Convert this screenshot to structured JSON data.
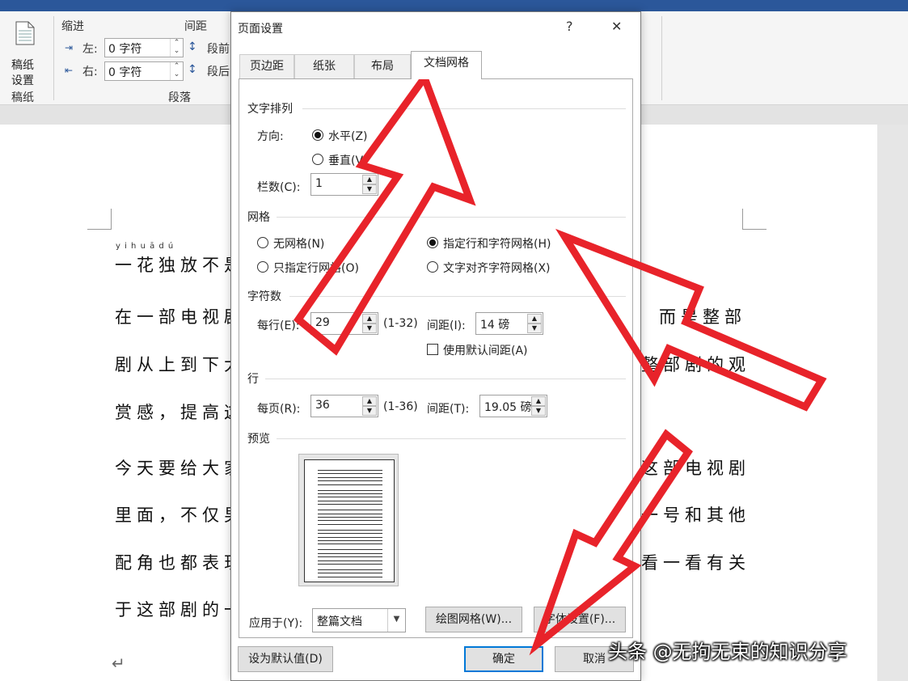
{
  "ribbon": {
    "gaozhi_btn": "稿纸\n设置",
    "gaozhi_label_l1": "稿纸",
    "gaozhi_label_l2": "设置",
    "gaozhi_group": "稿纸",
    "indent_title": "缩进",
    "spacing_title": "间距",
    "left_label": "左:",
    "left_value": "0 字符",
    "right_label": "右:",
    "right_value": "0 字符",
    "before_label": "段前",
    "after_label": "段后",
    "paragraph_group": "段落"
  },
  "document": {
    "pinyin": "y i h u ā d ú",
    "lines": [
      "一花独放不是",
      "在一部电视剧",
      "剧从上到下大",
      "赏感，提高这",
      "今天要给大家",
      "里面，不仅男",
      "配角也都表现",
      "于这部剧的一"
    ],
    "right_fragments": [
      "而是整部",
      "整部剧的观",
      "这部电视剧",
      "一号和其他",
      "看一看有关"
    ],
    "para_mark": "↵"
  },
  "dialog": {
    "title": "页面设置",
    "help": "?",
    "close": "✕",
    "tabs": [
      "页边距",
      "纸张",
      "布局",
      "文档网格"
    ],
    "text_direction": {
      "section": "文字排列",
      "direction_label": "方向:",
      "horizontal": "水平(Z)",
      "vertical": "垂直(V)",
      "columns_label": "栏数(C):",
      "columns_value": "1"
    },
    "grid": {
      "section": "网格",
      "no_grid": "无网格(N)",
      "line_and_char": "指定行和字符网格(H)",
      "line_only": "只指定行网格(O)",
      "snap_chars": "文字对齐字符网格(X)"
    },
    "chars": {
      "section": "字符数",
      "per_line_label": "每行(E):",
      "per_line_value": "29",
      "per_line_range": "(1-32)",
      "pitch_label": "间距(I):",
      "pitch_value": "14 磅",
      "use_default": "使用默认间距(A)"
    },
    "lines": {
      "section": "行",
      "per_page_label": "每页(R):",
      "per_page_value": "36",
      "per_page_range": "(1-36)",
      "pitch_label": "间距(T):",
      "pitch_value": "19.05 磅"
    },
    "preview": {
      "section": "预览"
    },
    "apply_label": "应用于(Y):",
    "apply_value": "整篇文档",
    "drawing_grid": "绘图网格(W)...",
    "font_settings": "字体设置(F)...",
    "set_default": "设为默认值(D)",
    "ok": "确定",
    "cancel": "取消"
  },
  "watermark": "头条 @无拘无束的知识分享",
  "colors": {
    "title_bar": "#2b579a",
    "annotation_arrow": "#e8232a",
    "primary_border": "#0078d7"
  }
}
